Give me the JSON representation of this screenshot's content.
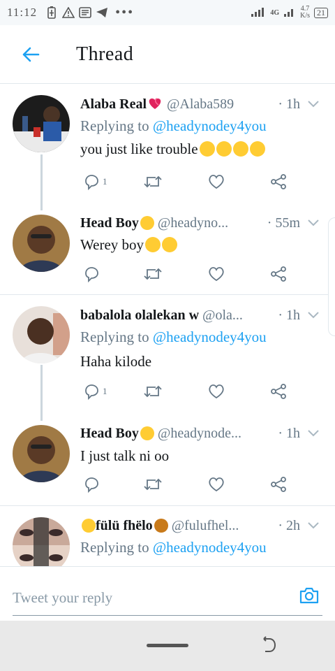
{
  "status_bar": {
    "time": "11:12",
    "network": "4G",
    "speed_value": "4.7",
    "speed_unit": "K/s",
    "battery": "21"
  },
  "header": {
    "title": "Thread"
  },
  "tweets": [
    {
      "name": "Alaba Real",
      "handle": "@Alaba589",
      "time": "· 1h",
      "reply_prefix": "Replying to ",
      "reply_to": "@headynodey4you",
      "text": "you just like trouble",
      "reply_count": "1",
      "avatar_colors": [
        "#2a2a2a",
        "#b13b2a"
      ]
    },
    {
      "name": "Head Boy",
      "handle": "@headyno...",
      "time": "· 55m",
      "text": "Werey boy",
      "reply_count": "",
      "avatar_colors": [
        "#8a6a3a",
        "#3a3040"
      ]
    },
    {
      "name": "babalola olalekan w",
      "handle": "@ola...",
      "time": "· 1h",
      "reply_prefix": "Replying to ",
      "reply_to": "@headynodey4you",
      "text": "Haha kilode",
      "reply_count": "1",
      "avatar_colors": [
        "#d9d0c8",
        "#3a2a22"
      ]
    },
    {
      "name": "Head Boy",
      "handle": "@headynode...",
      "time": "· 1h",
      "text": "I just talk ni oo",
      "reply_count": "",
      "avatar_colors": [
        "#8a6a3a",
        "#3a3040"
      ]
    },
    {
      "name": "fülü fhëlo",
      "handle": "@fulufhel...",
      "time": "· 2h",
      "reply_prefix": "Replying to ",
      "reply_to": "@headynodey4you",
      "avatar_colors": [
        "#c9a99a",
        "#2a2a2a"
      ]
    }
  ],
  "compose": {
    "placeholder": "Tweet your reply"
  },
  "colors": {
    "accent": "#1da1f2",
    "secondary_text": "#657786",
    "divider": "#e1e8ed"
  },
  "icons": [
    "back-arrow-icon",
    "reply-icon",
    "retweet-icon",
    "like-icon",
    "share-icon",
    "chevron-down-icon",
    "camera-icon"
  ]
}
